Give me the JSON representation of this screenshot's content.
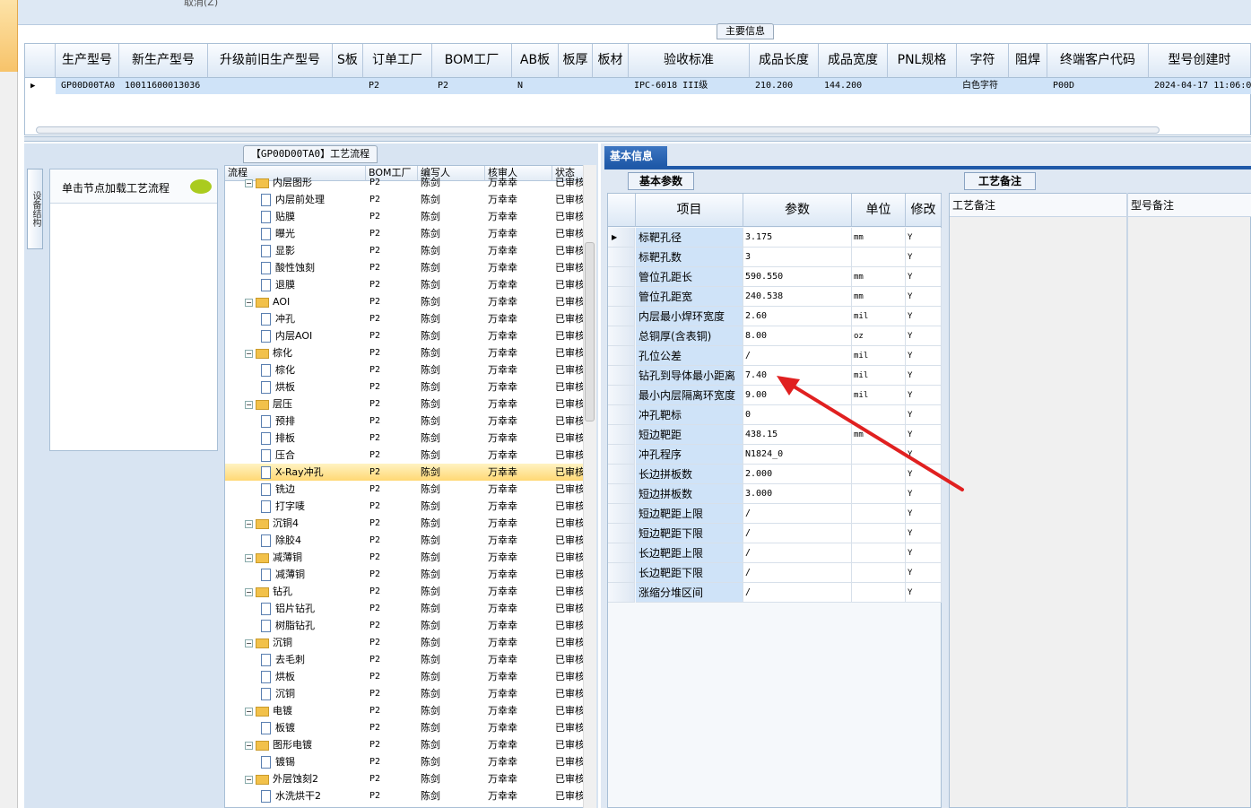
{
  "top": {
    "cancel_label": "取消(Z)"
  },
  "main_info": {
    "tab_label": "主要信息",
    "columns": [
      "生产型号",
      "新生产型号",
      "升级前旧生产型号",
      "S板",
      "订单工厂",
      "BOM工厂",
      "AB板",
      "板厚",
      "板材",
      "验收标准",
      "成品长度",
      "成品宽度",
      "PNL规格",
      "字符",
      "阻焊",
      "终端客户代码",
      "型号创建时"
    ],
    "row": [
      "GP00D00TA0",
      "10011600013036",
      "",
      "",
      "P2",
      "P2",
      "N",
      "",
      "",
      "IPC-6018 III级",
      "210.200",
      "144.200",
      "",
      "白色字符",
      "",
      "P00D",
      "2024-04-17 11:06:09"
    ]
  },
  "side_tab": "设备结构",
  "load_box": {
    "header": "单击节点加载工艺流程"
  },
  "flow": {
    "tab_label": "【GP00D00TA0】工艺流程",
    "columns": [
      "流程",
      "BOM工厂",
      "编写人",
      "核审人",
      "状态"
    ],
    "rows": [
      {
        "name": "内层图形",
        "type": "folder",
        "level": 0,
        "bom": "P2",
        "writer": "陈剑",
        "reviewer": "万幸幸",
        "status": "已审核"
      },
      {
        "name": "内层前处理",
        "type": "doc",
        "level": 1,
        "bom": "P2",
        "writer": "陈剑",
        "reviewer": "万幸幸",
        "status": "已审核"
      },
      {
        "name": "贴膜",
        "type": "doc",
        "level": 1,
        "bom": "P2",
        "writer": "陈剑",
        "reviewer": "万幸幸",
        "status": "已审核"
      },
      {
        "name": "曝光",
        "type": "doc",
        "level": 1,
        "bom": "P2",
        "writer": "陈剑",
        "reviewer": "万幸幸",
        "status": "已审核"
      },
      {
        "name": "显影",
        "type": "doc",
        "level": 1,
        "bom": "P2",
        "writer": "陈剑",
        "reviewer": "万幸幸",
        "status": "已审核"
      },
      {
        "name": "酸性蚀刻",
        "type": "doc",
        "level": 1,
        "bom": "P2",
        "writer": "陈剑",
        "reviewer": "万幸幸",
        "status": "已审核"
      },
      {
        "name": "退膜",
        "type": "doc",
        "level": 1,
        "bom": "P2",
        "writer": "陈剑",
        "reviewer": "万幸幸",
        "status": "已审核"
      },
      {
        "name": "AOI",
        "type": "folder",
        "level": 0,
        "bom": "P2",
        "writer": "陈剑",
        "reviewer": "万幸幸",
        "status": "已审核"
      },
      {
        "name": "冲孔",
        "type": "doc",
        "level": 1,
        "bom": "P2",
        "writer": "陈剑",
        "reviewer": "万幸幸",
        "status": "已审核"
      },
      {
        "name": "内层AOI",
        "type": "doc",
        "level": 1,
        "bom": "P2",
        "writer": "陈剑",
        "reviewer": "万幸幸",
        "status": "已审核"
      },
      {
        "name": "棕化",
        "type": "folder",
        "level": 0,
        "bom": "P2",
        "writer": "陈剑",
        "reviewer": "万幸幸",
        "status": "已审核"
      },
      {
        "name": "棕化",
        "type": "doc",
        "level": 1,
        "bom": "P2",
        "writer": "陈剑",
        "reviewer": "万幸幸",
        "status": "已审核"
      },
      {
        "name": "烘板",
        "type": "doc",
        "level": 1,
        "bom": "P2",
        "writer": "陈剑",
        "reviewer": "万幸幸",
        "status": "已审核"
      },
      {
        "name": "层压",
        "type": "folder",
        "level": 0,
        "bom": "P2",
        "writer": "陈剑",
        "reviewer": "万幸幸",
        "status": "已审核"
      },
      {
        "name": "预排",
        "type": "doc",
        "level": 1,
        "bom": "P2",
        "writer": "陈剑",
        "reviewer": "万幸幸",
        "status": "已审核"
      },
      {
        "name": "排板",
        "type": "doc",
        "level": 1,
        "bom": "P2",
        "writer": "陈剑",
        "reviewer": "万幸幸",
        "status": "已审核"
      },
      {
        "name": "压合",
        "type": "doc",
        "level": 1,
        "bom": "P2",
        "writer": "陈剑",
        "reviewer": "万幸幸",
        "status": "已审核"
      },
      {
        "name": "X-Ray冲孔",
        "type": "doc",
        "level": 1,
        "bom": "P2",
        "writer": "陈剑",
        "reviewer": "万幸幸",
        "status": "已审核",
        "selected": true
      },
      {
        "name": "铣边",
        "type": "doc",
        "level": 1,
        "bom": "P2",
        "writer": "陈剑",
        "reviewer": "万幸幸",
        "status": "已审核"
      },
      {
        "name": "打字唛",
        "type": "doc",
        "level": 1,
        "bom": "P2",
        "writer": "陈剑",
        "reviewer": "万幸幸",
        "status": "已审核"
      },
      {
        "name": "沉铜4",
        "type": "folder",
        "level": 0,
        "bom": "P2",
        "writer": "陈剑",
        "reviewer": "万幸幸",
        "status": "已审核"
      },
      {
        "name": "除胶4",
        "type": "doc",
        "level": 1,
        "bom": "P2",
        "writer": "陈剑",
        "reviewer": "万幸幸",
        "status": "已审核"
      },
      {
        "name": "减薄铜",
        "type": "folder",
        "level": 0,
        "bom": "P2",
        "writer": "陈剑",
        "reviewer": "万幸幸",
        "status": "已审核"
      },
      {
        "name": "减薄铜",
        "type": "doc",
        "level": 1,
        "bom": "P2",
        "writer": "陈剑",
        "reviewer": "万幸幸",
        "status": "已审核"
      },
      {
        "name": "钻孔",
        "type": "folder",
        "level": 0,
        "bom": "P2",
        "writer": "陈剑",
        "reviewer": "万幸幸",
        "status": "已审核"
      },
      {
        "name": "铝片钻孔",
        "type": "doc",
        "level": 1,
        "bom": "P2",
        "writer": "陈剑",
        "reviewer": "万幸幸",
        "status": "已审核"
      },
      {
        "name": "树脂钻孔",
        "type": "doc",
        "level": 1,
        "bom": "P2",
        "writer": "陈剑",
        "reviewer": "万幸幸",
        "status": "已审核"
      },
      {
        "name": "沉铜",
        "type": "folder",
        "level": 0,
        "bom": "P2",
        "writer": "陈剑",
        "reviewer": "万幸幸",
        "status": "已审核"
      },
      {
        "name": "去毛刺",
        "type": "doc",
        "level": 1,
        "bom": "P2",
        "writer": "陈剑",
        "reviewer": "万幸幸",
        "status": "已审核"
      },
      {
        "name": "烘板",
        "type": "doc",
        "level": 1,
        "bom": "P2",
        "writer": "陈剑",
        "reviewer": "万幸幸",
        "status": "已审核"
      },
      {
        "name": "沉铜",
        "type": "doc",
        "level": 1,
        "bom": "P2",
        "writer": "陈剑",
        "reviewer": "万幸幸",
        "status": "已审核"
      },
      {
        "name": "电镀",
        "type": "folder",
        "level": 0,
        "bom": "P2",
        "writer": "陈剑",
        "reviewer": "万幸幸",
        "status": "已审核"
      },
      {
        "name": "板镀",
        "type": "doc",
        "level": 1,
        "bom": "P2",
        "writer": "陈剑",
        "reviewer": "万幸幸",
        "status": "已审核"
      },
      {
        "name": "图形电镀",
        "type": "folder",
        "level": 0,
        "bom": "P2",
        "writer": "陈剑",
        "reviewer": "万幸幸",
        "status": "已审核"
      },
      {
        "name": "镀锡",
        "type": "doc",
        "level": 1,
        "bom": "P2",
        "writer": "陈剑",
        "reviewer": "万幸幸",
        "status": "已审核"
      },
      {
        "name": "外层蚀刻2",
        "type": "folder",
        "level": 0,
        "bom": "P2",
        "writer": "陈剑",
        "reviewer": "万幸幸",
        "status": "已审核"
      },
      {
        "name": "水洗烘干2",
        "type": "doc",
        "level": 1,
        "bom": "P2",
        "writer": "陈剑",
        "reviewer": "万幸幸",
        "status": "已审核"
      }
    ]
  },
  "basic_info": {
    "tab_label": "基本信息",
    "param_tab": "基本参数",
    "columns": [
      "项目",
      "参数",
      "单位",
      "修改"
    ],
    "rows": [
      {
        "item": "标靶孔径",
        "value": "3.175",
        "unit": "mm",
        "mod": "Y"
      },
      {
        "item": "标靶孔数",
        "value": "3",
        "unit": "",
        "mod": "Y"
      },
      {
        "item": "管位孔距长",
        "value": "590.550",
        "unit": "mm",
        "mod": "Y"
      },
      {
        "item": "管位孔距宽",
        "value": "240.538",
        "unit": "mm",
        "mod": "Y"
      },
      {
        "item": "内层最小焊环宽度",
        "value": "2.60",
        "unit": "mil",
        "mod": "Y"
      },
      {
        "item": "总铜厚(含表铜)",
        "value": "8.00",
        "unit": "oz",
        "mod": "Y"
      },
      {
        "item": "孔位公差",
        "value": "/",
        "unit": "mil",
        "mod": "Y"
      },
      {
        "item": "钻孔到导体最小距离",
        "value": "7.40",
        "unit": "mil",
        "mod": "Y"
      },
      {
        "item": "最小内层隔离环宽度",
        "value": "9.00",
        "unit": "mil",
        "mod": "Y"
      },
      {
        "item": "冲孔靶标",
        "value": "0",
        "unit": "",
        "mod": "Y"
      },
      {
        "item": "短边靶距",
        "value": "438.15",
        "unit": "mm",
        "mod": "Y"
      },
      {
        "item": "冲孔程序",
        "value": "N1824_0",
        "unit": "",
        "mod": "Y"
      },
      {
        "item": "长边拼板数",
        "value": "2.000",
        "unit": "",
        "mod": "Y"
      },
      {
        "item": "短边拼板数",
        "value": "3.000",
        "unit": "",
        "mod": "Y"
      },
      {
        "item": "短边靶距上限",
        "value": "/",
        "unit": "",
        "mod": "Y"
      },
      {
        "item": "短边靶距下限",
        "value": "/",
        "unit": "",
        "mod": "Y"
      },
      {
        "item": "长边靶距上限",
        "value": "/",
        "unit": "",
        "mod": "Y"
      },
      {
        "item": "长边靶距下限",
        "value": "/",
        "unit": "",
        "mod": "Y"
      },
      {
        "item": "涨缩分堆区间",
        "value": "/",
        "unit": "",
        "mod": "Y"
      }
    ]
  },
  "remarks": {
    "tab_label": "工艺备注",
    "col1": "工艺备注",
    "col2": "型号备注"
  },
  "colors": {
    "accent": "#1f59a8",
    "selection": "#cfe3f8",
    "arrow": "#e02020"
  }
}
